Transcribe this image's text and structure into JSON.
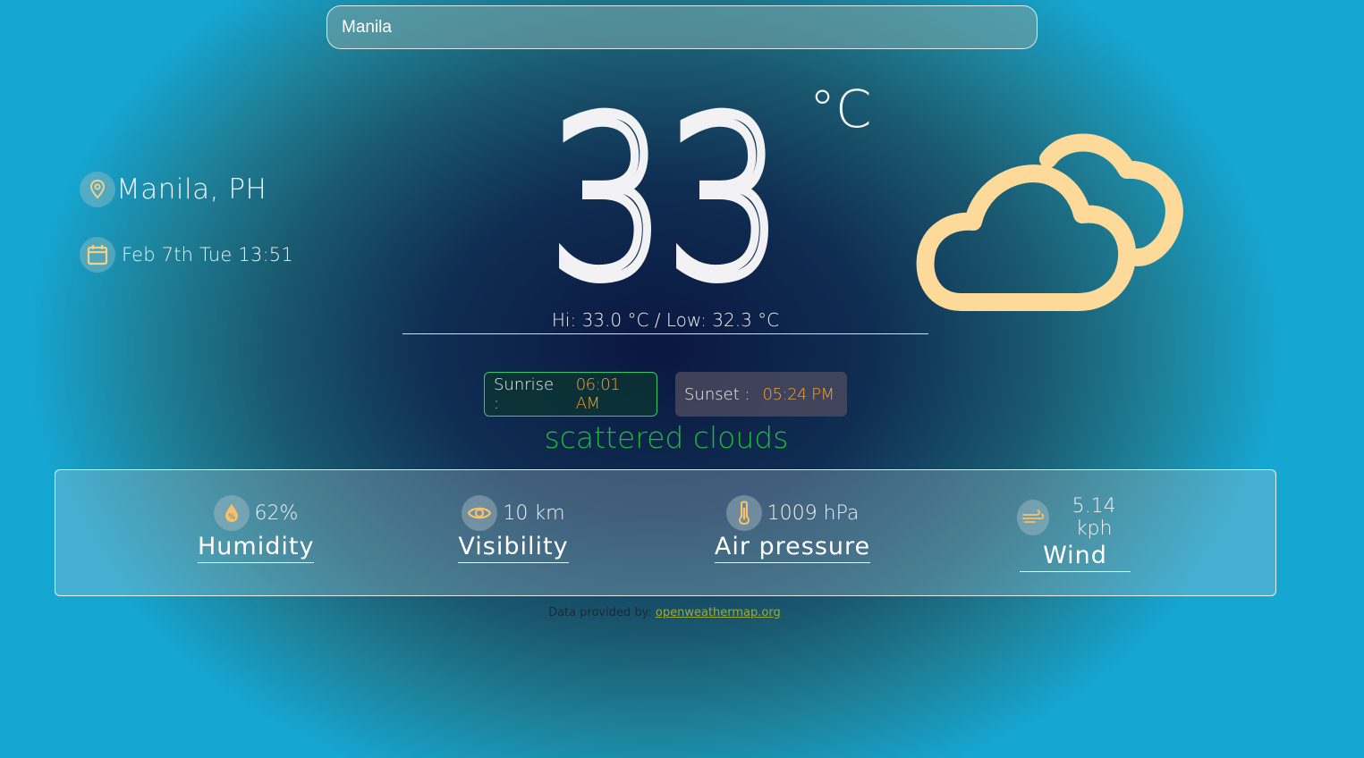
{
  "search": {
    "value": "Manila",
    "placeholder": ""
  },
  "location": {
    "name": "Manila, PH",
    "icon": "map-pin-icon"
  },
  "datetime": {
    "text": "Feb 7th Tue 13:51",
    "icon": "calendar-icon"
  },
  "temperature": {
    "value": "33",
    "unit": "°C",
    "hi_low": "Hi: 33.0 °C / Low: 32.3 °C"
  },
  "weather_icon": "cloud-icon",
  "sun": {
    "sunrise_label": "Sunrise :",
    "sunrise_value": "06:01 AM",
    "sunset_label": "Sunset :",
    "sunset_value": "05:24 PM"
  },
  "description": "scattered clouds",
  "stats": {
    "humidity": {
      "value": "62%",
      "label": "Humidity",
      "icon": "humidity-drop-icon"
    },
    "visibility": {
      "value": "10 km",
      "label": "Visibility",
      "icon": "eye-icon"
    },
    "pressure": {
      "value": "1009 hPa",
      "label": "Air pressure",
      "icon": "thermometer-icon"
    },
    "wind": {
      "value": "5.14 kph",
      "label": "Wind",
      "icon": "wind-icon"
    }
  },
  "credit": {
    "prefix": "Data provided by:",
    "link_text": "openweathermap.org"
  },
  "colors": {
    "accent_icon": "#f5d08a",
    "cloud": "#fdd99a",
    "description": "#1dbb39",
    "time_value": "#f3a033"
  }
}
